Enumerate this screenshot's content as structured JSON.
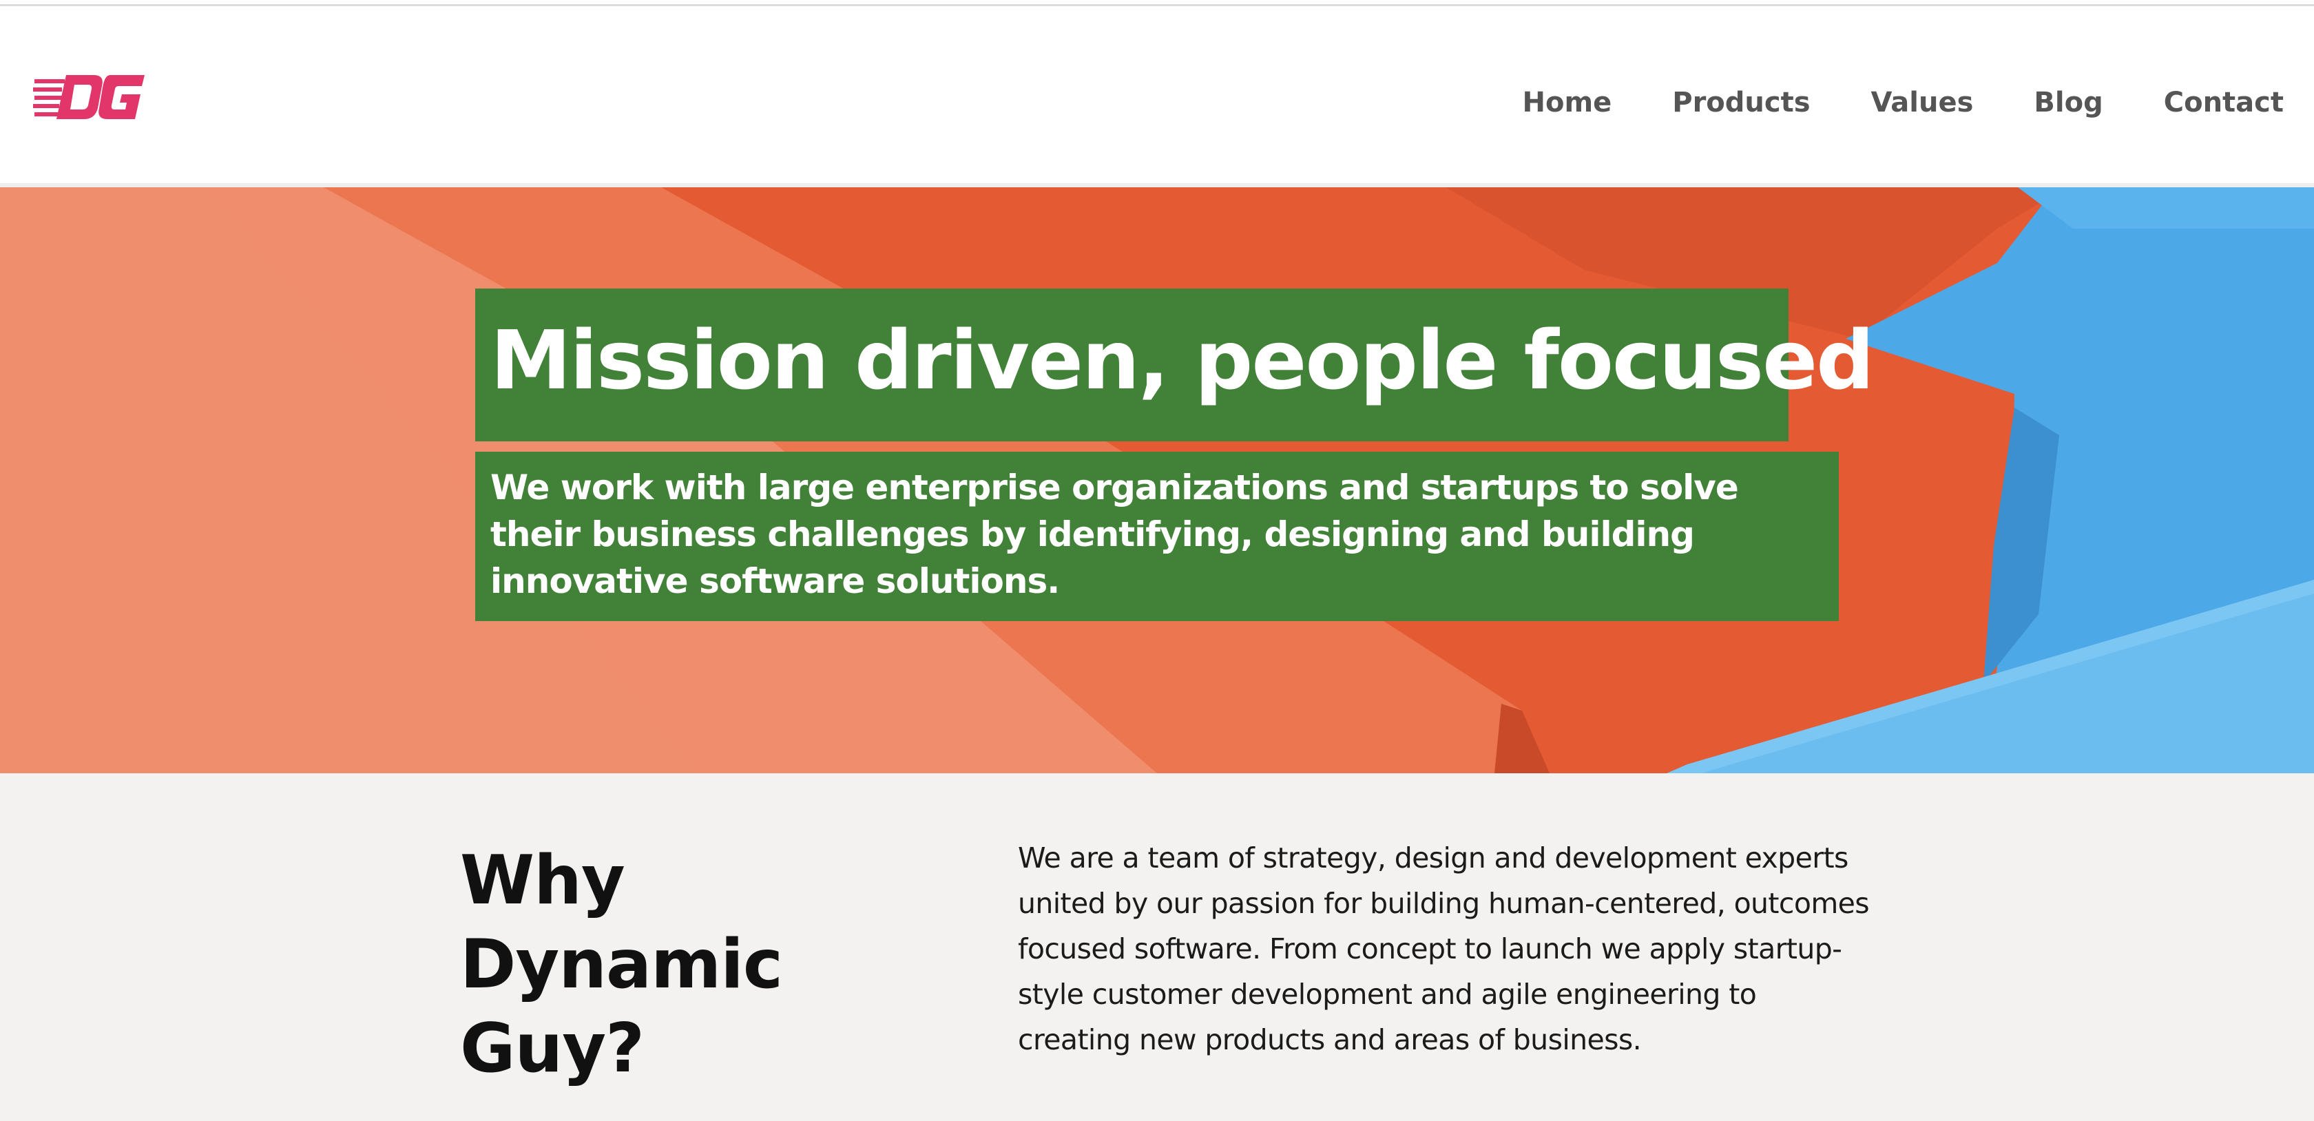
{
  "brand": {
    "logo_text": "DG",
    "logo_color": "#e2366a"
  },
  "nav": {
    "items": [
      {
        "label": "Home"
      },
      {
        "label": "Products"
      },
      {
        "label": "Values"
      },
      {
        "label": "Blog"
      },
      {
        "label": "Contact"
      }
    ]
  },
  "hero": {
    "title": "Mission driven, people focused",
    "subtitle": "We work with large enterprise organizations and startups to solve their business challenges by identifying, designing and building innovative software solutions.",
    "box_color": "#428238"
  },
  "why": {
    "heading": "Why Dynamic Guy?",
    "body": "We are a team of strategy, design and development experts united by our passion for building human-centered, outcomes focused software. From concept to launch we apply startup-style customer development and agile engineering to creating new products and areas of business."
  }
}
